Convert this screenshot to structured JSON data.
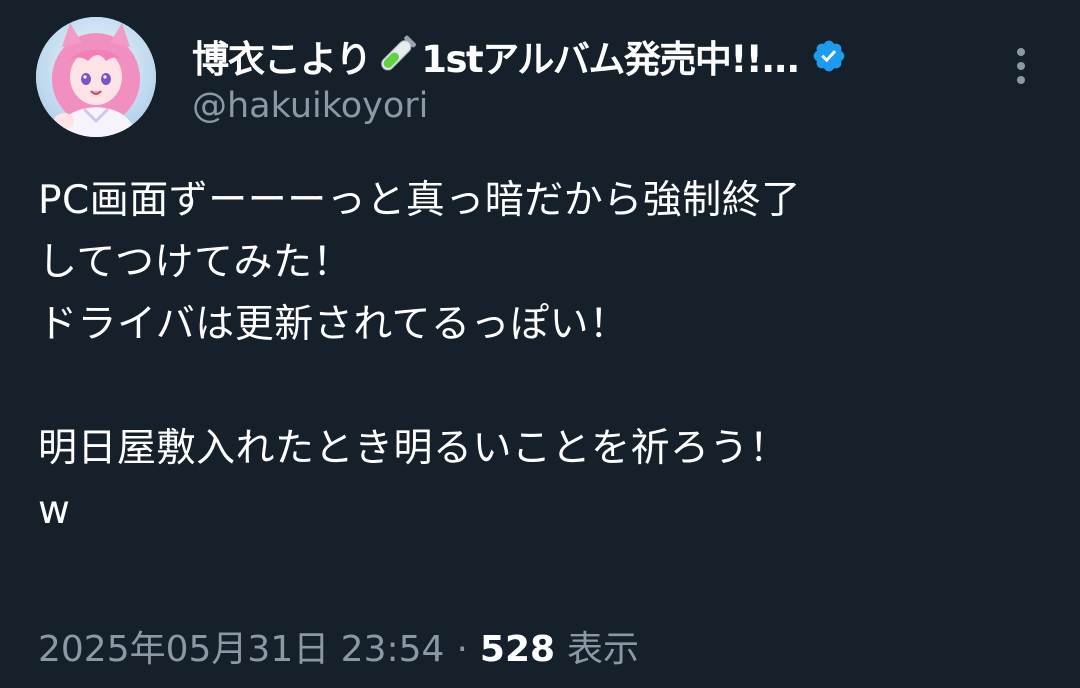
{
  "user": {
    "display_name": "博衣こより",
    "display_name_suffix": "1stアルバム発売中!!...",
    "name_emoji_icon": "test-tube-icon",
    "verified_icon": "verified-badge-icon",
    "handle": "@hakuikoyori"
  },
  "tweet": {
    "text": "PC画面ずーーーっと真っ暗だから強制終了\nしてつけてみた！\nドライバは更新されてるっぽい！\n\n明日屋敷入れたとき明るいことを祈ろう！\nw",
    "timestamp": "2025年05月31日 23:54",
    "separator": "·",
    "views_count": "528",
    "views_label": "表示"
  },
  "colors": {
    "background": "#15202b",
    "text_primary": "#ffffff",
    "text_secondary": "#8b98a5",
    "verified": "#1d9bf0"
  },
  "icons": {
    "more": "more-vertical-icon",
    "avatar": "avatar"
  }
}
